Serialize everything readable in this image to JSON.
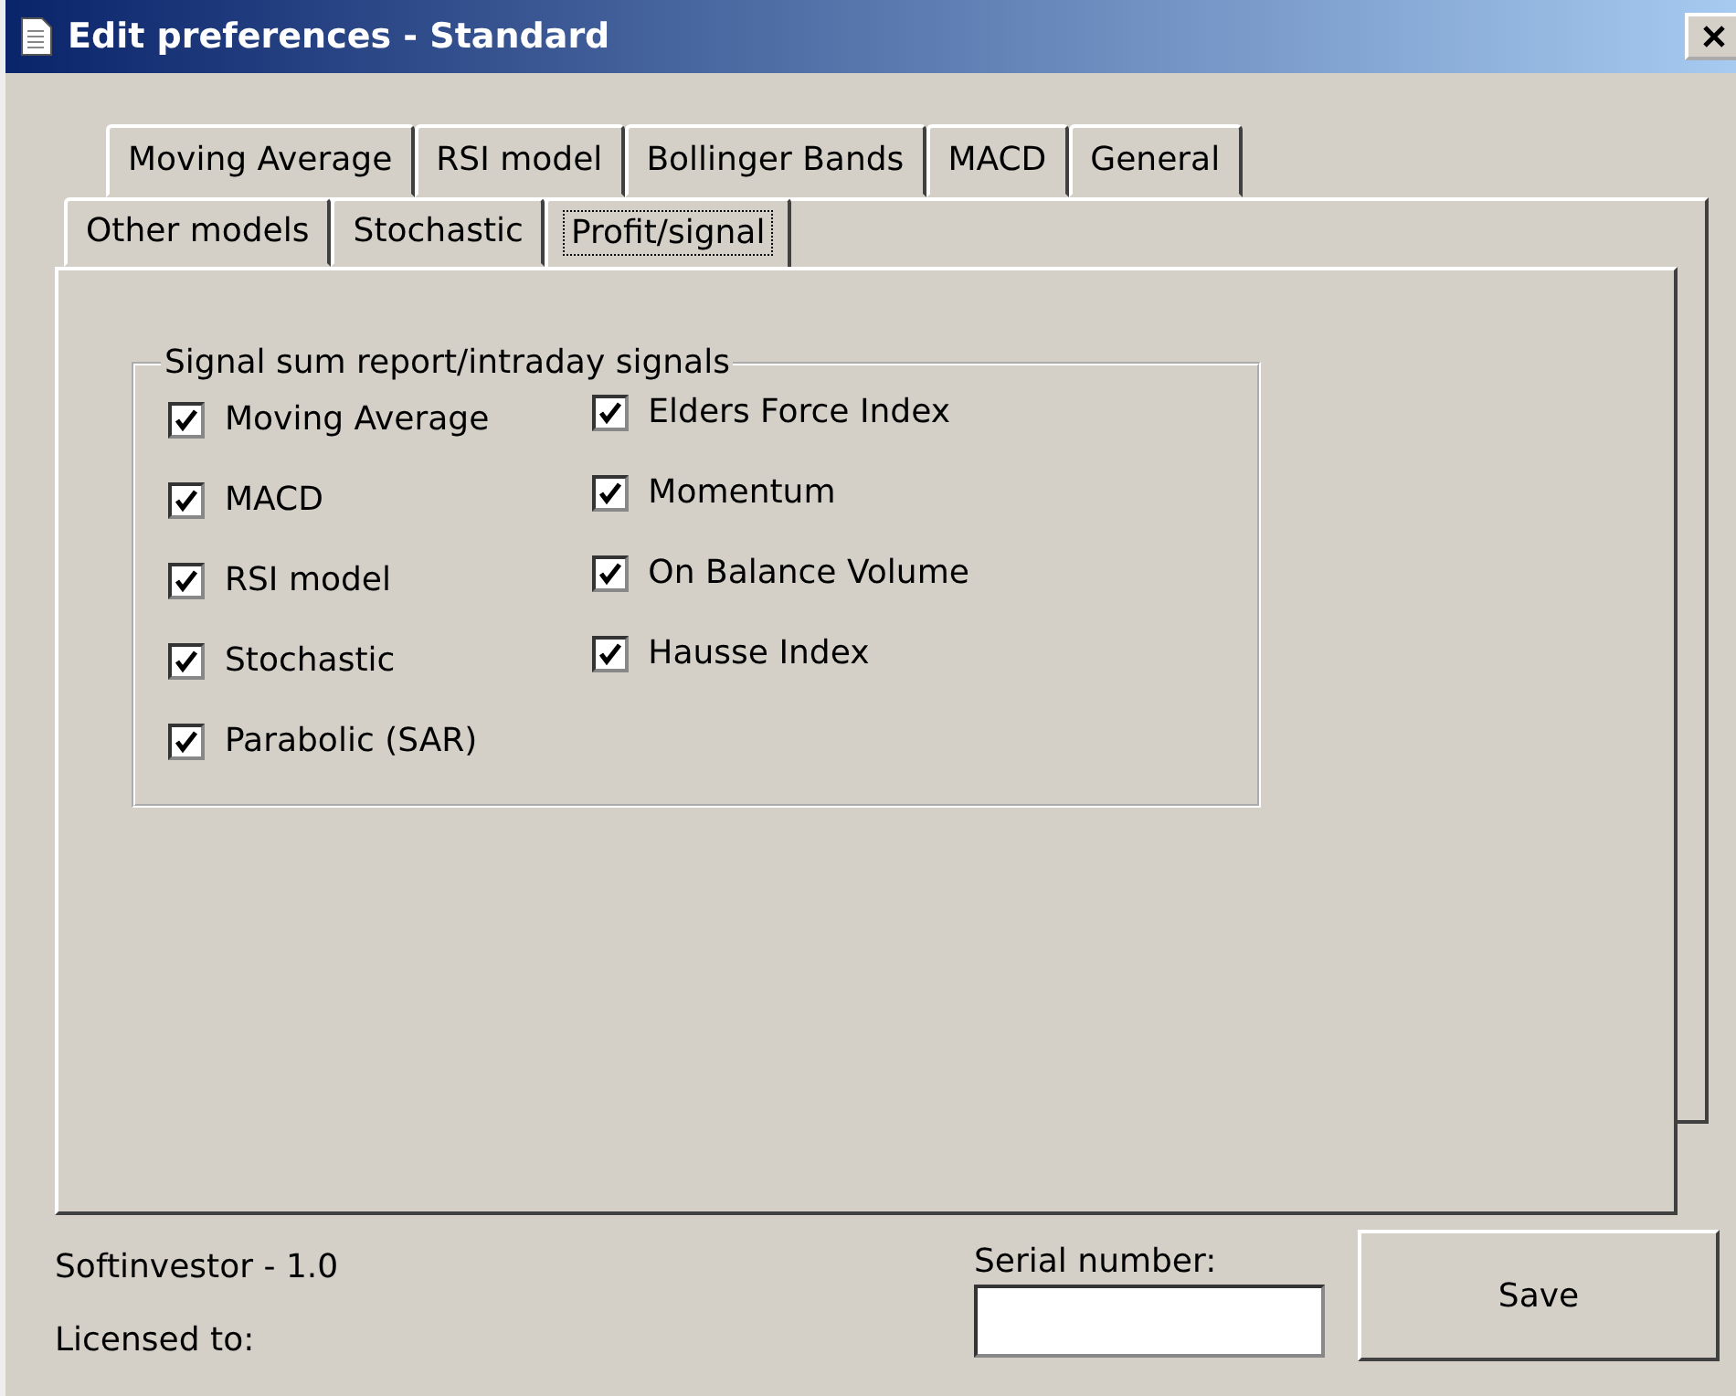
{
  "window": {
    "title": "Edit preferences - Standard"
  },
  "tab_rows": [
    {
      "tabs": [
        {
          "label": "Moving Average",
          "selected": false
        },
        {
          "label": "RSI model",
          "selected": false
        },
        {
          "label": "Bollinger Bands",
          "selected": false
        },
        {
          "label": "MACD",
          "selected": false
        },
        {
          "label": "General",
          "selected": false
        }
      ]
    },
    {
      "tabs": [
        {
          "label": "Other models",
          "selected": false
        },
        {
          "label": "Stochastic",
          "selected": false
        },
        {
          "label": "Profit/signal",
          "selected": true
        }
      ]
    }
  ],
  "group": {
    "title": "Signal sum report/intraday signals",
    "columns": [
      [
        {
          "label": "Moving Average",
          "checked": true
        },
        {
          "label": "MACD",
          "checked": true
        },
        {
          "label": "RSI model",
          "checked": true
        },
        {
          "label": "Stochastic",
          "checked": true
        },
        {
          "label": "Parabolic (SAR)",
          "checked": true
        }
      ],
      [
        {
          "label": "Elders Force Index",
          "checked": true
        },
        {
          "label": "Momentum",
          "checked": true
        },
        {
          "label": "On Balance Volume",
          "checked": true
        },
        {
          "label": "Hausse Index",
          "checked": true
        }
      ]
    ]
  },
  "footer": {
    "app_version": "Softinvestor - 1.0",
    "licensed_to_label": "Licensed to:",
    "serial_label": "Serial number:",
    "save_button": "Save"
  }
}
